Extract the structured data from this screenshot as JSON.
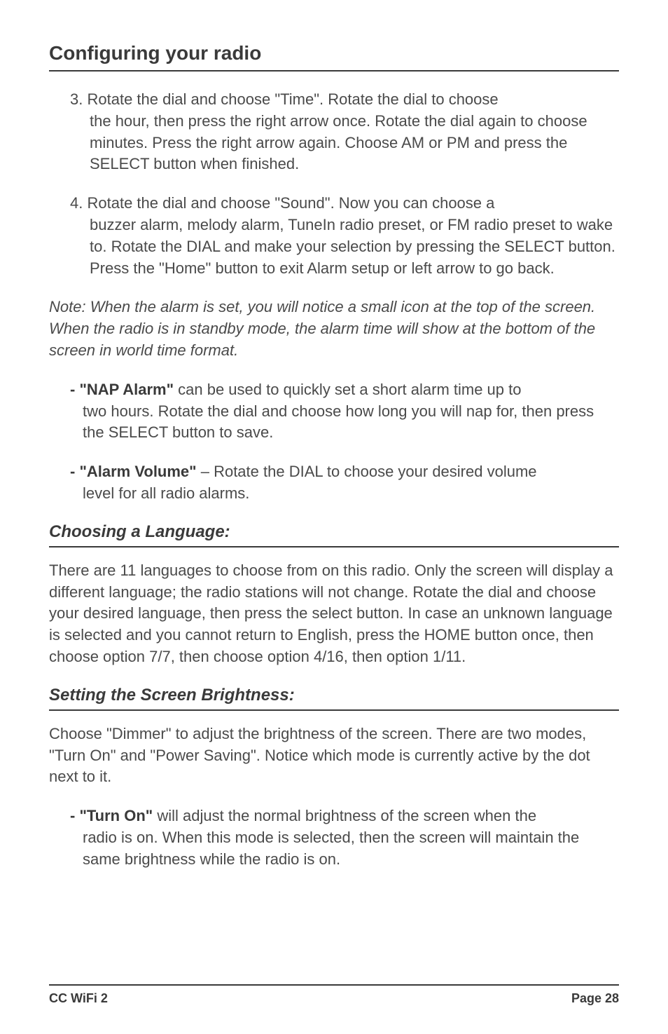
{
  "pageTitle": "Configuring your radio",
  "item3": {
    "num": "3.",
    "firstLine": "Rotate the dial and choose \"Time\". Rotate the dial to choose",
    "rest": "the hour, then press the right arrow once. Rotate the dial again to choose minutes. Press the right arrow again. Choose AM or PM and press the SELECT button when finished."
  },
  "item4": {
    "num": "4.",
    "firstLine": "Rotate the dial and choose \"Sound\". Now you can choose a",
    "rest": "buzzer alarm, melody alarm, TuneIn radio preset, or FM radio preset to wake to. Rotate the DIAL and make your selection by pressing the SELECT button. Press the \"Home\" button to exit Alarm setup or left arrow to go back."
  },
  "note": "Note: When the alarm is set, you will notice a small icon at the top of the screen. When the radio is in standby mode, the alarm time will show at the bottom of the screen in world time format.",
  "napAlarm": {
    "label": "- \"NAP Alarm\"",
    "firstLine": " can be used to quickly set a short alarm time up to",
    "rest": "two hours. Rotate the dial and choose how long you will nap for, then press the SELECT button to save."
  },
  "alarmVolume": {
    "label": "- \"Alarm Volume\"",
    "firstLine": " – Rotate the DIAL to choose your desired volume",
    "rest": "level for all radio alarms."
  },
  "subheading1": "Choosing a Language:",
  "languagePara": "There are 11 languages to choose from on this radio. Only the screen will display a different language; the radio stations will not change. Rotate the dial and choose your desired language, then press the select button. In case an unknown language is selected and you cannot return to English, press the HOME button once, then choose option 7/7, then choose option 4/16, then option 1/11.",
  "subheading2": "Setting the Screen Brightness:",
  "brightnessPara": "Choose \"Dimmer\" to adjust the brightness of the screen. There are two modes, \"Turn On\" and \"Power Saving\". Notice which mode is currently active by the dot next to it.",
  "turnOn": {
    "label": "- \"Turn On\"",
    "firstLine": " will adjust the normal brightness of the screen when the",
    "rest": "radio is on. When this mode is selected, then the screen will maintain the same brightness while the radio is on."
  },
  "footer": {
    "left": "CC WiFi 2",
    "right": "Page 28"
  }
}
